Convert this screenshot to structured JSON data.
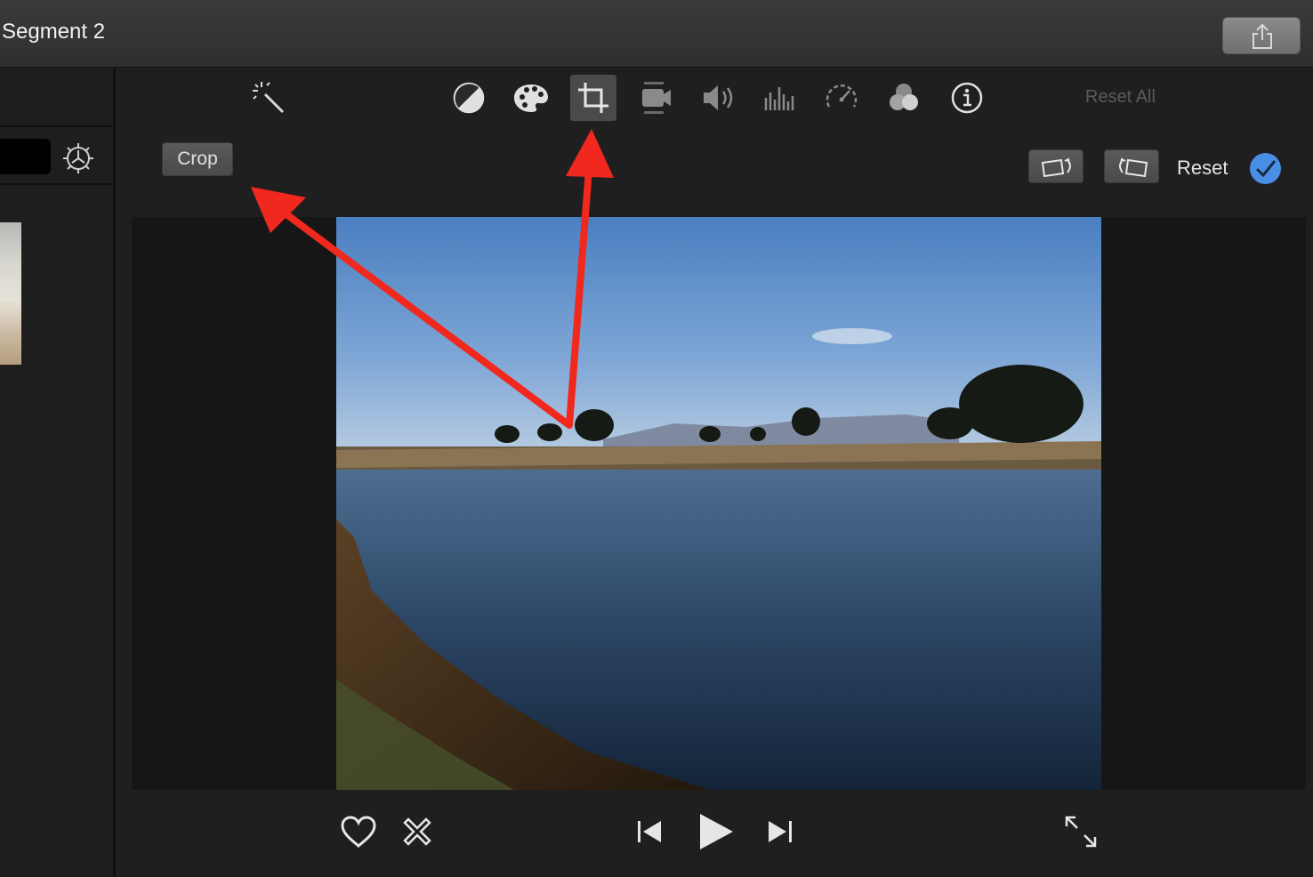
{
  "window": {
    "title": "Segment 2"
  },
  "toolbar": {
    "tools": [
      {
        "name": "auto-enhance",
        "icon": "magic-wand-icon"
      },
      {
        "name": "color-balance",
        "icon": "half-circle-icon"
      },
      {
        "name": "color-correction",
        "icon": "palette-icon"
      },
      {
        "name": "cropping",
        "icon": "crop-icon",
        "active": true
      },
      {
        "name": "stabilization",
        "icon": "camera-icon"
      },
      {
        "name": "volume",
        "icon": "speaker-icon"
      },
      {
        "name": "noise-reduction",
        "icon": "equalizer-icon"
      },
      {
        "name": "speed",
        "icon": "speedometer-icon"
      },
      {
        "name": "clip-filter",
        "icon": "color-circles-icon"
      },
      {
        "name": "clip-info",
        "icon": "info-icon"
      }
    ],
    "reset_all_label": "Reset All"
  },
  "crop_row": {
    "crop_label": "Crop",
    "reset_label": "Reset"
  },
  "colors": {
    "accent": "#4a8fe6",
    "annotation_arrow": "#f0281e",
    "active_tool_bg": "#4a4a4a"
  },
  "playback": {
    "buttons": [
      "heart-icon",
      "reject-icon",
      "skip-back-icon",
      "play-icon",
      "skip-forward-icon",
      "fullscreen-icon"
    ]
  }
}
